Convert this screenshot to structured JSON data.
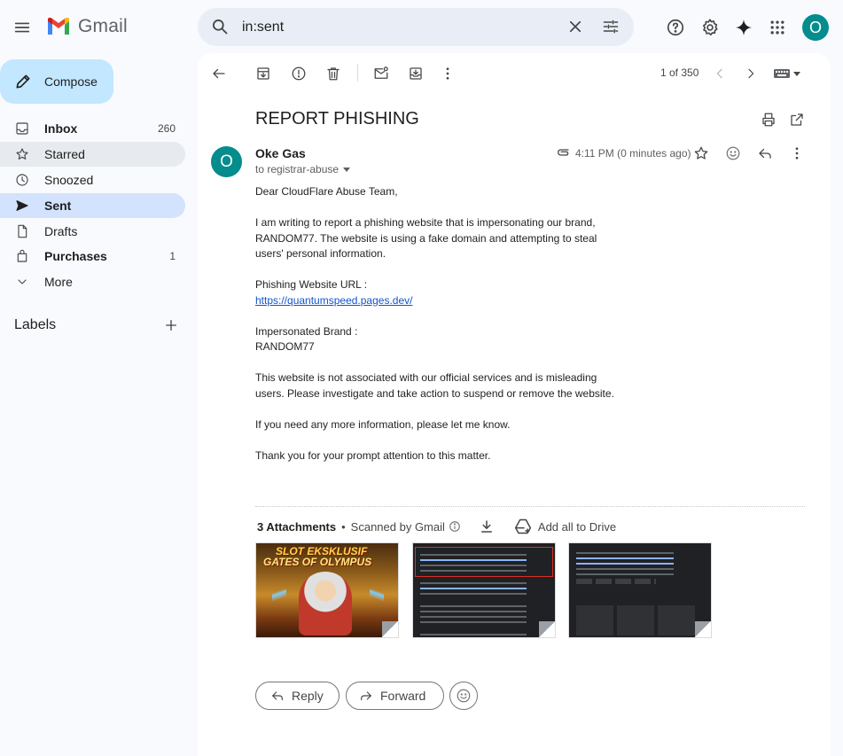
{
  "app": {
    "name": "Gmail"
  },
  "search": {
    "value": "in:sent"
  },
  "account": {
    "initial": "O"
  },
  "compose": {
    "label": "Compose"
  },
  "sidebar": {
    "items": [
      {
        "label": "Inbox",
        "count": "260"
      },
      {
        "label": "Starred",
        "count": ""
      },
      {
        "label": "Snoozed",
        "count": ""
      },
      {
        "label": "Sent",
        "count": ""
      },
      {
        "label": "Drafts",
        "count": ""
      },
      {
        "label": "Purchases",
        "count": "1"
      },
      {
        "label": "More",
        "count": ""
      }
    ],
    "labels_title": "Labels"
  },
  "toolbar": {
    "pager": "1 of 350"
  },
  "email": {
    "subject": "REPORT PHISHING",
    "sender_initial": "O",
    "sender_name": "Oke Gas",
    "recipient": "to registrar-abuse",
    "timestamp": "4:11 PM (0 minutes ago)",
    "body": {
      "greeting": "Dear CloudFlare Abuse Team,",
      "p1": "I am writing to report a phishing website that is impersonating our brand, RANDOM77. The website is using a fake domain and attempting to steal users' personal information.",
      "url_label": "Phishing Website URL :",
      "url": "https://quantumspeed.pages.dev/",
      "brand_label": "Impersonated Brand :",
      "brand": "RANDOM77",
      "p2": "This website is not associated with our official services and is misleading users. Please investigate and take action to suspend or remove the website.",
      "p3": "If you need any more information, please let me know.",
      "p4": "Thank you for your prompt attention to this matter."
    },
    "attachments": {
      "count_label": "3 Attachments",
      "scanned_label": "Scanned by Gmail",
      "drive_label": "Add all to Drive",
      "thumb1_title_line1": "SLOT EKSKLUSIF",
      "thumb1_title_line2": "GATES OF OLYMPUS"
    }
  },
  "actions": {
    "reply": "Reply",
    "forward": "Forward"
  },
  "colors": {
    "accent": "#c2e7ff",
    "active_nav": "#d3e3fd",
    "avatar": "#058c8c",
    "link": "#1155cc"
  }
}
